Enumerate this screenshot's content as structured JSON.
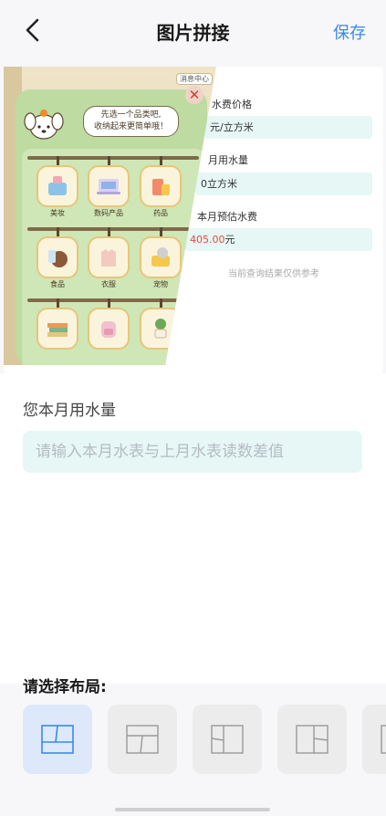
{
  "header": {
    "title": "图片拼接",
    "save_label": "保存"
  },
  "collage": {
    "right_card": {
      "price_label": "水费价格",
      "price_value": "元/立方米",
      "usage_label": "月用水量",
      "usage_value": "0立方米",
      "estimate_label": "本月预估水费",
      "estimate_value": "405.00",
      "estimate_unit": "元",
      "note": "当前查询结果仅供参考"
    },
    "left_panel": {
      "badge": "消息中心",
      "bubble_line1": "先选一个品类吧,",
      "bubble_line2": "收纳起来更简单哦！",
      "categories": [
        "美妆",
        "数码产品",
        "药品",
        "食品",
        "衣服",
        "宠物"
      ]
    }
  },
  "water_section": {
    "label": "您本月用水量",
    "placeholder": "请输入本月水表与上月水表读数差值"
  },
  "layout_picker": {
    "title": "请选择布局:",
    "options": [
      "layout-1",
      "layout-2",
      "layout-3",
      "layout-4",
      "layout-5"
    ],
    "selected_index": 0
  },
  "colors": {
    "accent": "#3a8ae8",
    "field_bg": "#e6f7f5",
    "estimate_red": "#e8493a"
  }
}
